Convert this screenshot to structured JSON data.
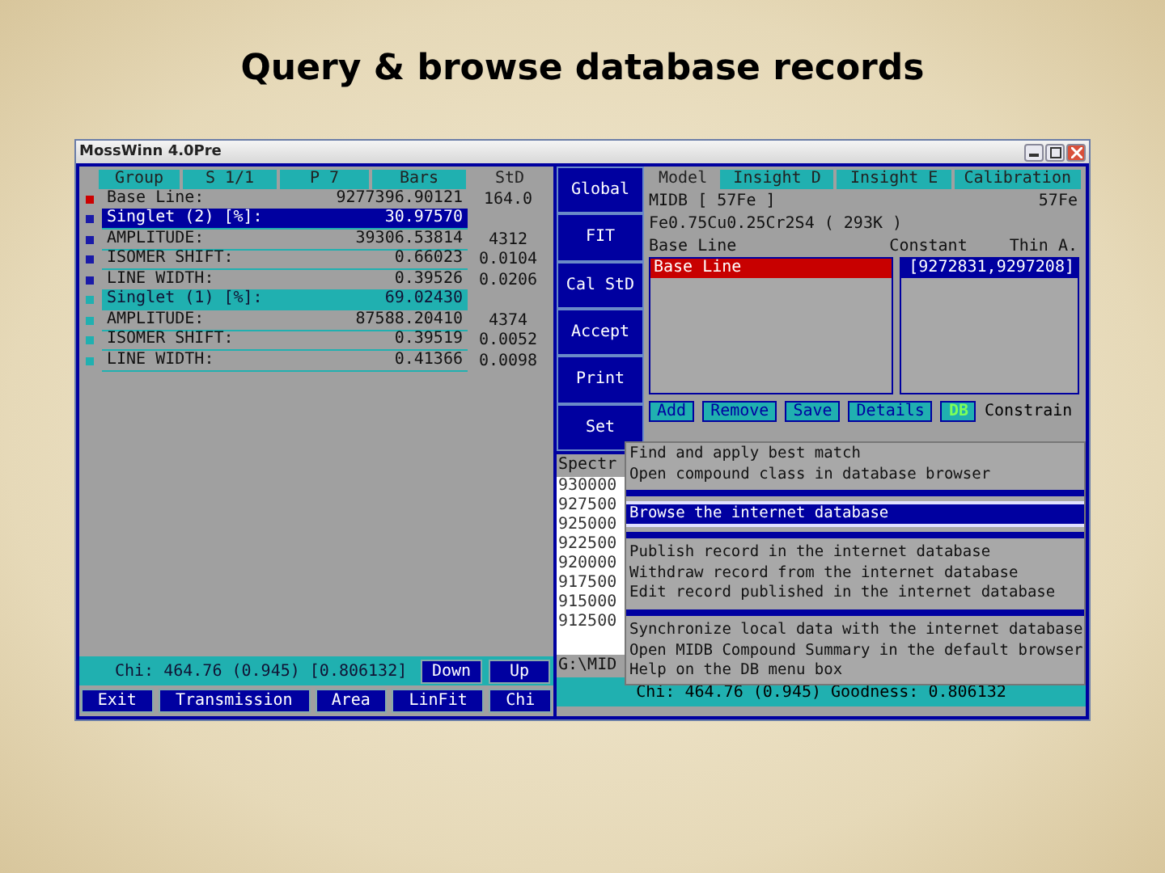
{
  "slide": {
    "title": "Query & browse database records"
  },
  "window": {
    "title": "MossWinn 4.0Pre"
  },
  "parameters": {
    "columns": [
      "Group",
      "S 1/1",
      "P 7",
      "Bars",
      "StD"
    ],
    "rows": [
      {
        "kind": "line",
        "name": "Base Line:",
        "value": "9277396.90121",
        "std": "164.0",
        "color": "#cc0000",
        "selected": false
      },
      {
        "kind": "group",
        "name": "Singlet (2) [%]:",
        "value": "30.97570",
        "color": "#1a1aa8",
        "selected": true
      },
      {
        "kind": "param",
        "name": "AMPLITUDE:",
        "value": "39306.53814",
        "std": "4312",
        "color": "#1a1aa8",
        "selected": false
      },
      {
        "kind": "param",
        "name": "ISOMER SHIFT:",
        "value": "0.66023",
        "std": "0.0104",
        "color": "#1a1aa8",
        "selected": false
      },
      {
        "kind": "param",
        "name": "LINE WIDTH:",
        "value": "0.39526",
        "std": "0.0206",
        "color": "#1a1aa8",
        "selected": false
      },
      {
        "kind": "group",
        "name": "Singlet (1) [%]:",
        "value": "69.02430",
        "color": "#20b0b0",
        "selected": false
      },
      {
        "kind": "param",
        "name": "AMPLITUDE:",
        "value": "87588.20410",
        "std": "4374",
        "color": "#20b0b0",
        "selected": false
      },
      {
        "kind": "param",
        "name": "ISOMER SHIFT:",
        "value": "0.39519",
        "std": "0.0052",
        "color": "#20b0b0",
        "selected": false
      },
      {
        "kind": "param",
        "name": "LINE WIDTH:",
        "value": "0.41366",
        "std": "0.0098",
        "color": "#20b0b0",
        "selected": false
      }
    ]
  },
  "left_status": {
    "text": "Chi: 464.76 (0.945) [0.806132]",
    "buttons": [
      "Down",
      "Up"
    ]
  },
  "bottom_buttons": [
    "Exit",
    "Transmission",
    "Area",
    "LinFit",
    "Chi"
  ],
  "side_buttons": [
    "Global",
    "FIT",
    "Cal StD",
    "Accept",
    "Print",
    "Set"
  ],
  "model": {
    "tabs": [
      {
        "label": "Model",
        "selected": true
      },
      {
        "label": "Insight D",
        "selected": false
      },
      {
        "label": "Insight E",
        "selected": false
      },
      {
        "label": "Calibration",
        "selected": false
      }
    ],
    "database": "MIDB [ 57Fe ]",
    "isotope": "57Fe",
    "compound": "Fe0.75Cu0.25Cr2S4 ( 293K )",
    "component": "Base Line",
    "type": "Constant",
    "absorber": "Thin A.",
    "components": [
      {
        "label": "Base Line",
        "selected": true
      }
    ],
    "ranges": [
      {
        "label": "[9272831,9297208]",
        "selected": true
      }
    ],
    "actions": [
      {
        "label": "Add",
        "selected": false
      },
      {
        "label": "Remove",
        "selected": false
      },
      {
        "label": "Save",
        "selected": false
      },
      {
        "label": "Details",
        "selected": false
      },
      {
        "label": "DB",
        "selected": true
      }
    ],
    "constrain": "Constrain"
  },
  "spectrum": {
    "header": "Spectr",
    "values": [
      "930000",
      "927500",
      "925000",
      "922500",
      "920000",
      "917500",
      "915000",
      "912500"
    ],
    "path": "G:\\MID",
    "status": "Chi: 464.76 (0.945)  Goodness: 0.806132"
  },
  "db_menu": {
    "items": [
      {
        "kind": "item",
        "label": "Find and apply best match",
        "selected": false
      },
      {
        "kind": "item",
        "label": "Open compound class in database browser",
        "selected": false
      },
      {
        "kind": "separator"
      },
      {
        "kind": "item",
        "label": "Browse the internet database",
        "selected": true
      },
      {
        "kind": "separator"
      },
      {
        "kind": "item",
        "label": "Publish record in the internet database",
        "selected": false
      },
      {
        "kind": "item",
        "label": "Withdraw record from the internet database",
        "selected": false
      },
      {
        "kind": "item",
        "label": "Edit record published in the internet database",
        "selected": false
      },
      {
        "kind": "separator"
      },
      {
        "kind": "item",
        "label": "Synchronize local data with the internet database",
        "selected": false
      },
      {
        "kind": "item",
        "label": "Open MIDB Compound Summary in the default browser",
        "selected": false
      },
      {
        "kind": "item",
        "label": "Help on the DB menu box",
        "selected": false
      }
    ]
  }
}
